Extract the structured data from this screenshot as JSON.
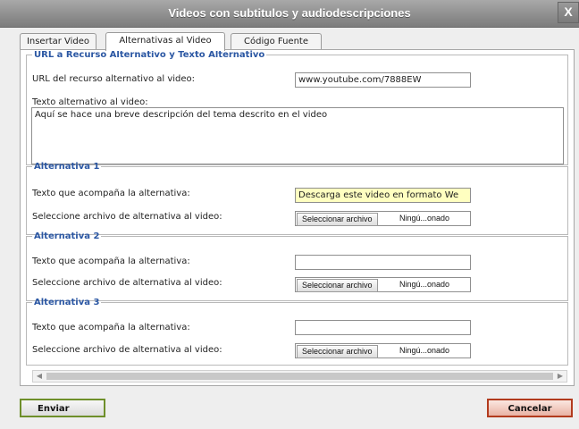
{
  "dialog": {
    "title": "Videos con subtitulos y audiodescripciones",
    "close_label": "X"
  },
  "tabs": [
    {
      "label": "Insertar Video",
      "active": false
    },
    {
      "label": "Alternativas al Video",
      "active": true
    },
    {
      "label": "Código Fuente",
      "active": false
    }
  ],
  "url_section": {
    "legend": "URL a Recurso Alternativo y Texto Alternativo",
    "url_label": "URL del recurso alternativo al video:",
    "url_value": "www.youtube.com/7888EW",
    "alt_text_label": "Texto alternativo al video:",
    "alt_text_value": "Aquí se hace una breve descripción del tema descrito en el video"
  },
  "alternatives": [
    {
      "legend": "Alternativa 1",
      "text_label": "Texto que acompaña la alternativa:",
      "text_value": "Descarga este video en formato We",
      "file_label": "Seleccione archivo de alternativa al video:",
      "file_button": "Seleccionar archivo",
      "file_status": "Ningú...onado"
    },
    {
      "legend": "Alternativa 2",
      "text_label": "Texto que acompaña la alternativa:",
      "text_value": "",
      "file_label": "Seleccione archivo de alternativa al video:",
      "file_button": "Seleccionar archivo",
      "file_status": "Ningú...onado"
    },
    {
      "legend": "Alternativa 3",
      "text_label": "Texto que acompaña la alternativa:",
      "text_value": "",
      "file_label": "Seleccione archivo de alternativa al video:",
      "file_button": "Seleccionar archivo",
      "file_status": "Ningú...onado"
    }
  ],
  "footer": {
    "submit_label": "Enviar",
    "cancel_label": "Cancelar"
  },
  "colors": {
    "legend_text": "#2b57a3",
    "highlight_field": "#ffffc0",
    "submit_border": "#6e8f2a",
    "cancel_border": "#b23b1e",
    "titlebar": "#8f8f8f"
  }
}
